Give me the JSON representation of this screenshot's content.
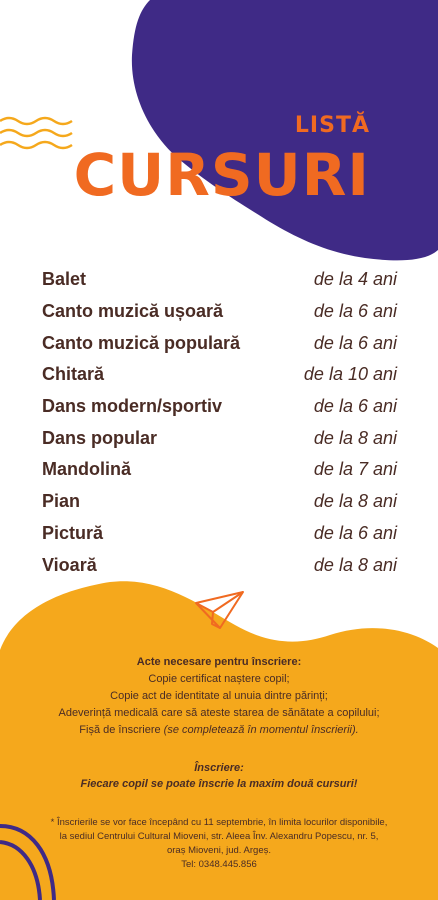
{
  "header": {
    "title_small": "LISTĂ",
    "title_big": "CURSURI"
  },
  "courses": [
    {
      "name": "Balet",
      "age": "de la 4 ani"
    },
    {
      "name": "Canto muzică ușoară",
      "age": "de la 6 ani"
    },
    {
      "name": "Canto muzică populară",
      "age": "de la 6 ani"
    },
    {
      "name": "Chitară",
      "age": "de la 10 ani"
    },
    {
      "name": "Dans modern/sportiv",
      "age": "de la 6 ani"
    },
    {
      "name": "Dans popular",
      "age": "de la 8 ani"
    },
    {
      "name": "Mandolină",
      "age": "de la 7 ani"
    },
    {
      "name": "Pian",
      "age": "de la 8 ani"
    },
    {
      "name": "Pictură",
      "age": "de la 6 ani"
    },
    {
      "name": "Vioară",
      "age": "de la 8 ani"
    }
  ],
  "documents": {
    "heading": "Acte necesare pentru înscriere:",
    "line1": "Copie certificat naștere copil;",
    "line2": "Copie act de identitate al unuia dintre părinți;",
    "line3": "Adeverință medicală care să ateste starea de sănătate a copilului;",
    "line4_prefix": "Fișă de înscriere ",
    "line4_note": "(se completează în momentul înscrierii)."
  },
  "enrollment": {
    "heading": "Înscriere:",
    "text": "Fiecare copil se poate înscrie la maxim două cursuri!"
  },
  "footer": {
    "line1": "* Înscrierile se vor face începând cu 11 septembrie, în limita locurilor disponibile,",
    "line2": "la sediul Centrului Cultural Mioveni, str. Aleea Înv. Alexandru Popescu, nr. 5,",
    "line3": "oraș Mioveni, jud. Argeș.",
    "line4": "Tel: 0348.445.856"
  },
  "colors": {
    "purple": "#3f2a86",
    "orange": "#f06a21",
    "yellow": "#f5a81c",
    "text": "#4a2c25"
  },
  "icons": [
    "wave-lines-icon",
    "paper-plane-icon",
    "arc-decoration-icon"
  ]
}
